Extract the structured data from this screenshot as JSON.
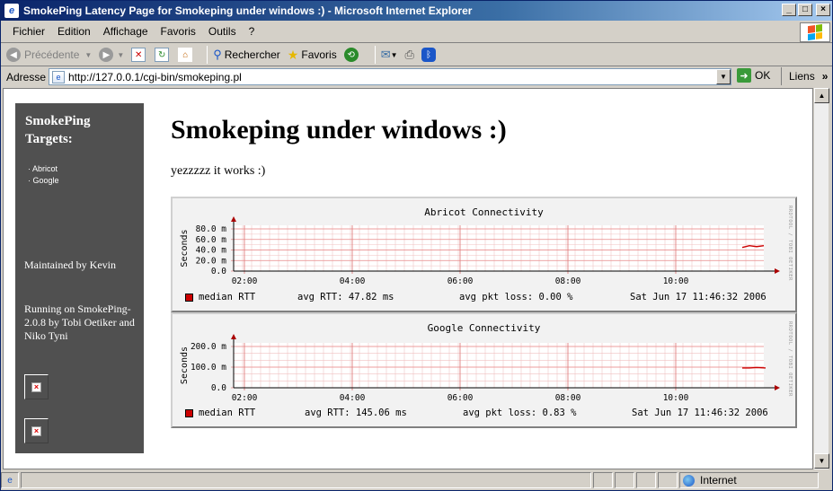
{
  "window": {
    "title": "SmokePing Latency Page for Smokeping under windows :) - Microsoft Internet Explorer"
  },
  "menu": [
    "Fichier",
    "Edition",
    "Affichage",
    "Favoris",
    "Outils",
    "?"
  ],
  "toolbar": {
    "back": "Précédente",
    "search": "Rechercher",
    "favorites": "Favoris"
  },
  "address": {
    "label": "Adresse",
    "url": "http://127.0.0.1/cgi-bin/smokeping.pl",
    "go": "OK",
    "links": "Liens"
  },
  "sidebar": {
    "title": "SmokePing Targets:",
    "targets": [
      "Abricot",
      "Google"
    ],
    "maintained": "Maintained by Kevin",
    "running": "Running on SmokePing-2.0.8 by Tobi Oetiker and Niko Tyni"
  },
  "page": {
    "heading": "Smokeping under windows :)",
    "intro": "yezzzzz it works :)"
  },
  "graphs": [
    {
      "title": "Abricot Connectivity",
      "ylabel": "Seconds",
      "yticks": [
        "80.0 m",
        "60.0 m",
        "40.0 m",
        "20.0 m",
        "0.0"
      ],
      "xticks": [
        "02:00",
        "04:00",
        "06:00",
        "08:00",
        "10:00"
      ],
      "legend": {
        "series": "median RTT",
        "avg_rtt": "avg RTT: 47.82 ms",
        "loss": "avg pkt loss: 0.00 %",
        "date": "Sat Jun 17 11:46:32 2006"
      },
      "watermark": "RRDTOOL / TOBI OETIKER"
    },
    {
      "title": "Google Connectivity",
      "ylabel": "Seconds",
      "yticks": [
        "200.0 m",
        "100.0 m",
        "0.0"
      ],
      "xticks": [
        "02:00",
        "04:00",
        "06:00",
        "08:00",
        "10:00"
      ],
      "legend": {
        "series": "median RTT",
        "avg_rtt": "avg RTT: 145.06 ms",
        "loss": "avg pkt loss: 0.83 %",
        "date": "Sat Jun 17 11:46:32 2006"
      },
      "watermark": "RRDTOOL / TOBI OETIKER"
    }
  ],
  "status": {
    "zone": "Internet"
  },
  "colors": {
    "title_start": "#0a246a",
    "title_end": "#a6caf0",
    "sidebar_bg": "#505050",
    "rtt_line": "#cc0000"
  },
  "icons": [
    "ie-page-icon",
    "minimize-icon",
    "maximize-icon",
    "close-icon",
    "windows-logo-icon",
    "back-arrow-icon",
    "forward-arrow-icon",
    "stop-icon",
    "refresh-icon",
    "home-icon",
    "search-icon",
    "favorites-star-icon",
    "history-icon",
    "mail-icon",
    "print-icon",
    "bluetooth-icon",
    "go-arrow-icon",
    "globe-icon",
    "broken-image-icon"
  ]
}
